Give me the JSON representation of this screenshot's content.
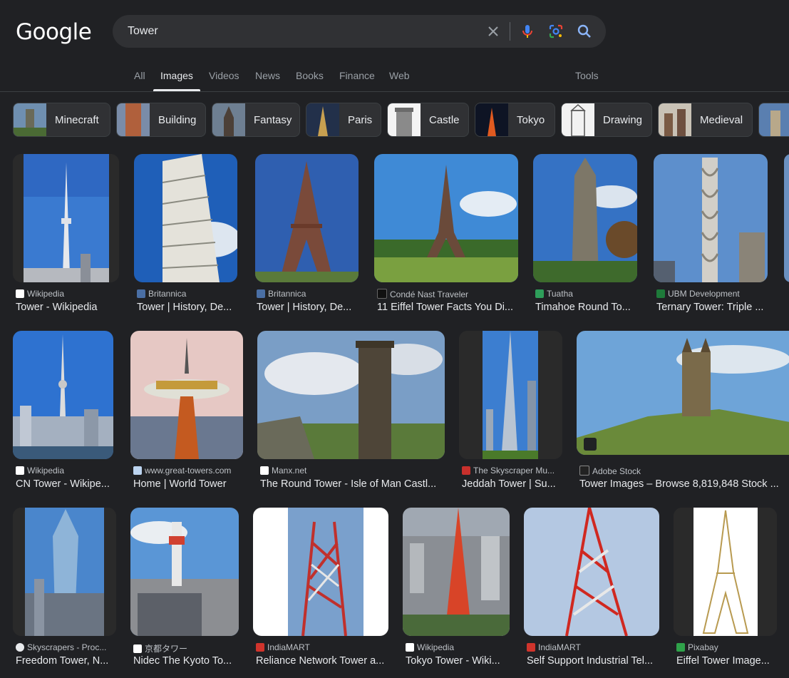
{
  "header": {
    "logo": "Google",
    "query": "Tower"
  },
  "tabs": [
    {
      "label": "All"
    },
    {
      "label": "Images"
    },
    {
      "label": "Videos"
    },
    {
      "label": "News"
    },
    {
      "label": "Books"
    },
    {
      "label": "Finance"
    },
    {
      "label": "Web"
    },
    {
      "label": "Tools"
    }
  ],
  "chips": [
    {
      "label": "Minecraft"
    },
    {
      "label": "Building"
    },
    {
      "label": "Fantasy"
    },
    {
      "label": "Paris"
    },
    {
      "label": "Castle"
    },
    {
      "label": "Tokyo"
    },
    {
      "label": "Drawing"
    },
    {
      "label": "Medieval"
    }
  ],
  "results": [
    {
      "source": "Wikipedia",
      "title": "Tower - Wikipedia"
    },
    {
      "source": "Britannica",
      "title": "Tower | History, De..."
    },
    {
      "source": "Britannica",
      "title": "Tower | History, De..."
    },
    {
      "source": "Condé Nast Traveler",
      "title": "11 Eiffel Tower Facts You Di..."
    },
    {
      "source": "Tuatha",
      "title": "Timahoe Round To..."
    },
    {
      "source": "UBM Development",
      "title": "Ternary Tower: Triple ..."
    },
    {
      "source": "Wikipedia",
      "title": "CN Tower - Wikipe..."
    },
    {
      "source": "www.great-towers.com",
      "title": "Home | World Tower"
    },
    {
      "source": "Manx.net",
      "title": "The Round Tower - Isle of Man Castl..."
    },
    {
      "source": "The Skyscraper Mu...",
      "title": "Jeddah Tower | Su..."
    },
    {
      "source": "Adobe Stock",
      "title": "Tower Images – Browse 8,819,848 Stock ..."
    },
    {
      "source": "Skyscrapers - Proc...",
      "title": "Freedom Tower, N..."
    },
    {
      "source": "京都タワー",
      "title": "Nidec The Kyoto To..."
    },
    {
      "source": "IndiaMART",
      "title": "Reliance Network Tower a..."
    },
    {
      "source": "Wikipedia",
      "title": "Tokyo Tower - Wiki..."
    },
    {
      "source": "IndiaMART",
      "title": "Self Support Industrial Tel..."
    },
    {
      "source": "Pixabay",
      "title": "Eiffel Tower Image..."
    }
  ],
  "colors": {
    "background": "#202124",
    "search_bg": "#303134",
    "text": "#e8eaed",
    "muted": "#9aa0a6"
  }
}
